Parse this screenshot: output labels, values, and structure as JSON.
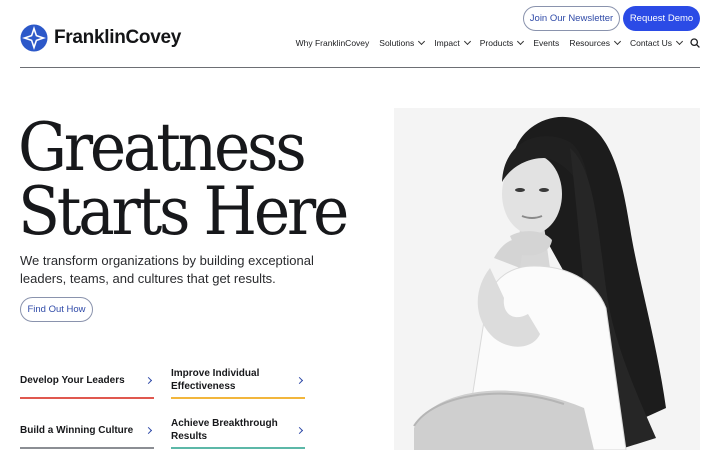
{
  "brand": {
    "name": "FranklinCovey"
  },
  "header": {
    "newsletter_label": "Join Our Newsletter",
    "demo_label": "Request Demo"
  },
  "nav": {
    "items": [
      {
        "label": "Why FranklinCovey",
        "has_dropdown": false
      },
      {
        "label": "Solutions",
        "has_dropdown": true
      },
      {
        "label": "Impact",
        "has_dropdown": true
      },
      {
        "label": "Products",
        "has_dropdown": true
      },
      {
        "label": "Events",
        "has_dropdown": false
      },
      {
        "label": "Resources",
        "has_dropdown": true
      },
      {
        "label": "Contact Us",
        "has_dropdown": true
      }
    ],
    "search_icon": "search-icon"
  },
  "hero": {
    "headline_line1": "Greatness",
    "headline_line2": "Starts Here",
    "subtext": "We transform organizations by building exceptional leaders, teams, and cultures that get results.",
    "cta_label": "Find Out How"
  },
  "cards": [
    {
      "label": "Develop Your Leaders",
      "accent": "#e0584f"
    },
    {
      "label": "Improve Individual Effectiveness",
      "accent": "#f2b63c"
    },
    {
      "label": "Build a Winning Culture",
      "accent": "#8b8e94"
    },
    {
      "label": "Achieve Breakthrough Results",
      "accent": "#5cb8a8"
    }
  ],
  "colors": {
    "accent_blue": "#2b4be6",
    "link_blue": "#2f4aa8"
  }
}
